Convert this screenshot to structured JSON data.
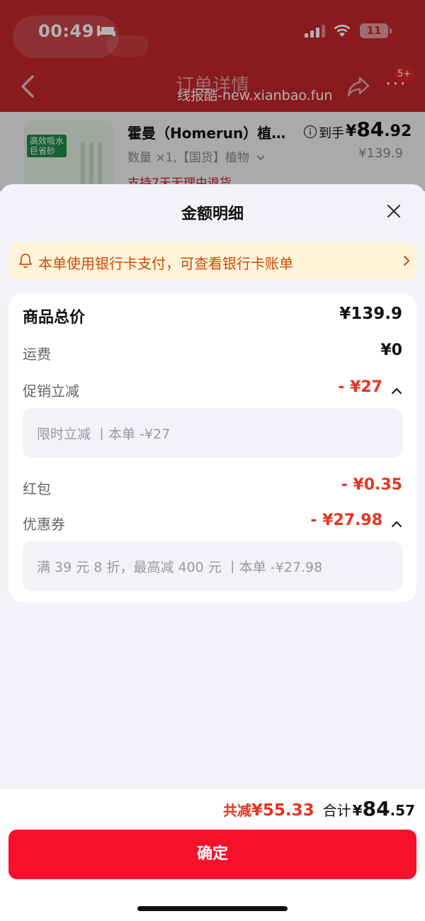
{
  "status_bar": {
    "time": "00:49",
    "battery": "11"
  },
  "nav": {
    "title": "订单详情",
    "badge": "5+",
    "more": "···"
  },
  "watermark": "线报酷-new.xianbao.fun",
  "product": {
    "name": "霍曼（Homerun）植…",
    "arrive_label": "到手",
    "price_symbol": "¥",
    "price_int": "84",
    "price_dec": ".92",
    "original_price": "¥139.9",
    "quantity": "数量 ×1,【国货】植物",
    "return_policy": "支持7天无理由退货",
    "image_text": {
      "line1": "高效吸水",
      "line2": "巨省砂"
    }
  },
  "sheet": {
    "title": "金额明细",
    "notice": "本单使用银行卡支付，可查看银行卡账单",
    "rows": {
      "total": {
        "label": "商品总价",
        "value": "¥139.9"
      },
      "shipping": {
        "label": "运费",
        "value": "¥0"
      },
      "promo": {
        "label": "促销立减",
        "value": "- ¥27",
        "detail": "限时立减 丨本单 -¥27"
      },
      "redpacket": {
        "label": "红包",
        "value": "- ¥0.35"
      },
      "coupon": {
        "label": "优惠券",
        "value": "- ¥27.98",
        "detail": "满 39 元 8 折，最高减 400 元 丨本单 -¥27.98"
      }
    }
  },
  "footer": {
    "saved_label": "共减",
    "saved_value": "¥55.33",
    "total_label": "合计",
    "total_symbol": "¥",
    "total_int": "84",
    "total_dec": ".57",
    "confirm_label": "确定"
  },
  "colors": {
    "accent_red": "#f7112b",
    "discount_red": "#e8331f",
    "notice_bg": "#fff4d9",
    "header_red": "#c4262c"
  },
  "icons": [
    "bed-icon",
    "signal-icon",
    "wifi-icon",
    "battery-icon",
    "back-icon",
    "share-icon",
    "more-icon",
    "info-icon",
    "chevron-down-icon",
    "close-icon",
    "bell-icon",
    "chevron-right-icon",
    "chevron-up-icon"
  ]
}
